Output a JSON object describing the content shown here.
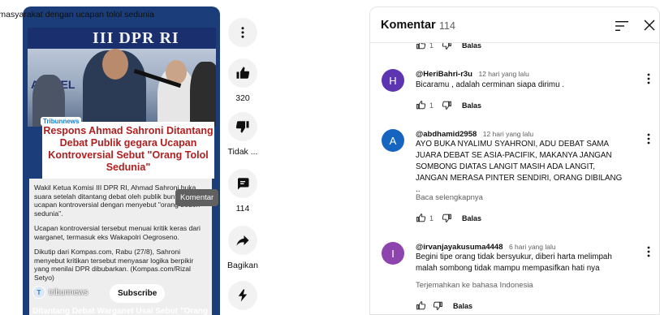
{
  "short": {
    "top_caption": "pon masyarakat dengan ucapan tolol sedunia",
    "banner_text": "III DPR RI",
    "banner_left_text": "ASI PEL",
    "logo_text": "Tribunnews",
    "headline": "Respons Ahmad Sahroni Ditantang Debat Publik gegara Ucapan Kontroversial Sebut \"Orang Tolol Sedunia\"",
    "paragraphs": [
      "Wakil Ketua Komisi III DPR RI, Ahmad Sahroni buka suara setelah ditantang debat oleh publik buntut ucapan kontroversial dengan menyebut \"orang bodoh sedunia\".",
      "Ucapan kontroversial tersebut menuai kritik keras dari warganet, termasuk eks Wakapolri Oegroseno.",
      "Dikutip dari Kompas.com, Rabu (27/8), Sahroni menyebut kritikan tersebut menyasar logika berpikir yang menilai DPR dibubarkan. (Kompas.com/Rizal Setyo)"
    ],
    "tooltip": "Komentar",
    "channel_avatar": "T",
    "channel_name": "tribunnews",
    "subscribe_label": "Subscribe",
    "bottom_title": "Ditantang Debat Warganet Usai Sebut \"Orang"
  },
  "actions": {
    "like_count": "320",
    "dislike_label": "Tidak ...",
    "comments_count": "114",
    "share_label": "Bagikan"
  },
  "comments_panel": {
    "title": "Komentar",
    "count": "114",
    "partial_like_count": "1",
    "partial_reply": "Balas",
    "comments": [
      {
        "avatar_letter": "H",
        "avatar_color": "#5e35b1",
        "author": "@HeriBahri-r3u",
        "time": "12 hari yang lalu",
        "text": "Bicaramu , adalah cerminan siapa dirimu .",
        "more": "",
        "likes": "1",
        "reply": "Balas"
      },
      {
        "avatar_letter": "A",
        "avatar_color": "#1565c0",
        "author": "@abdhamid2958",
        "time": "12 hari yang lalu",
        "text": "AYO BUKA NYALIMU SYAHRONI, ADU DEBAT SAMA JUARA DEBAT SE ASIA-PACIFIK, MAKANYA JANGAN SOMBONG DIATAS LANGIT MASIH ADA LANGIT, JANGAN MERASA PINTER SENDIRI, ORANG DIBILANG ..",
        "more": "Baca selengkapnya",
        "likes": "1",
        "reply": "Balas"
      },
      {
        "avatar_letter": "I",
        "avatar_color": "#8e44ad",
        "author": "@irvanjayakusuma4448",
        "time": "6 hari yang lalu",
        "text": "Begini tipe orang tidak bersyukur, diberi harta melimpah malah sombong tidak mampu mempasifkan hati nya",
        "more": "Terjemahkan ke bahasa Indonesia",
        "likes": "",
        "reply": "Balas"
      }
    ]
  }
}
